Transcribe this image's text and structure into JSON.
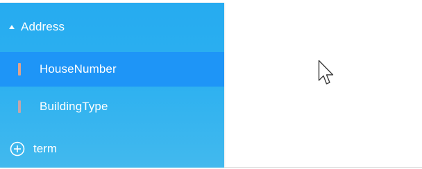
{
  "sidebar": {
    "group": {
      "label": "Address",
      "icon": "caret-up-icon",
      "expanded": true
    },
    "items": [
      {
        "label": "HouseNumber",
        "selected": true,
        "marker_color": "#e0a38c"
      },
      {
        "label": "BuildingType",
        "selected": false,
        "marker_color": "#c4a6ab"
      }
    ],
    "add_term": {
      "label": "term",
      "icon": "plus-circle-icon"
    }
  },
  "colors": {
    "sidebar_background": "#2cb0f0",
    "selected_background": "#1e95f7",
    "text": "#ffffff"
  },
  "pointer": {
    "icon": "mouse-cursor-icon"
  }
}
